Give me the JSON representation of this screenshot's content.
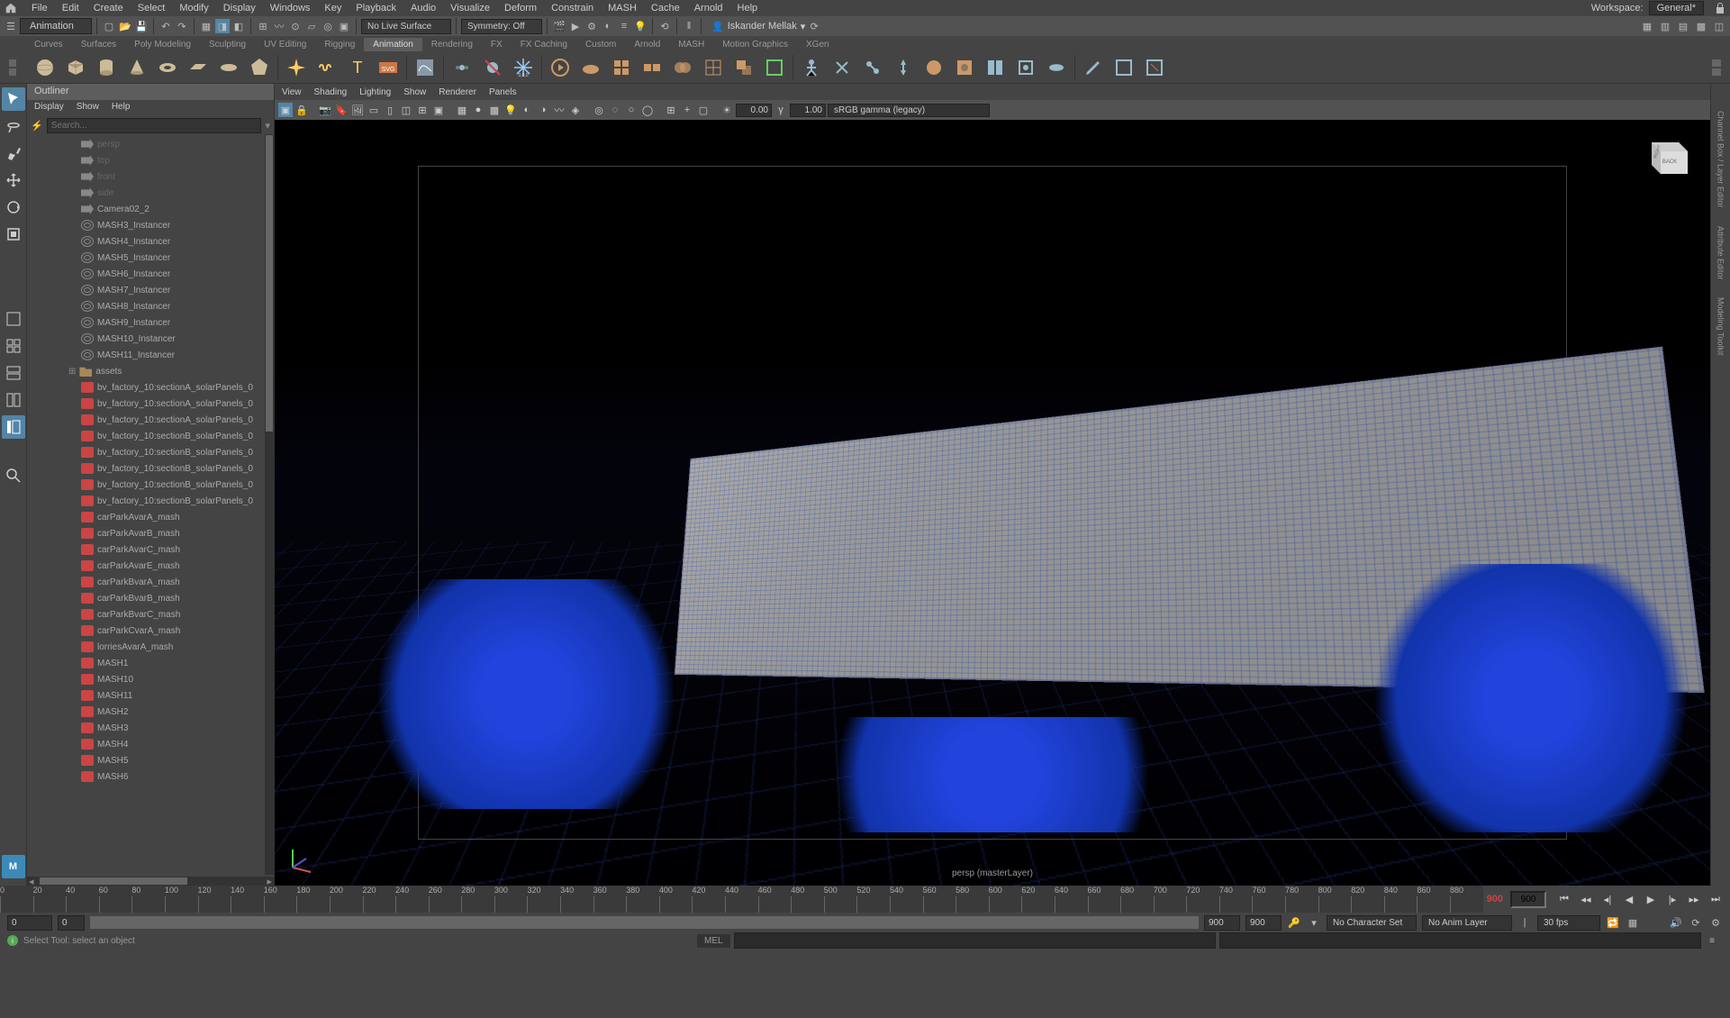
{
  "topMenu": {
    "items": [
      "File",
      "Edit",
      "Create",
      "Select",
      "Modify",
      "Display",
      "Windows",
      "Key",
      "Playback",
      "Audio",
      "Visualize",
      "Deform",
      "Constrain",
      "MASH",
      "Cache",
      "Arnold",
      "Help"
    ],
    "workspaceLabel": "Workspace:",
    "workspaceValue": "General*"
  },
  "statusBar": {
    "mode": "Animation",
    "noLiveSurface": "No Live Surface",
    "symmetry": "Symmetry: Off",
    "user": "Iskander Mellak"
  },
  "shelfTabs": [
    "Curves",
    "Surfaces",
    "Poly Modeling",
    "Sculpting",
    "UV Editing",
    "Rigging",
    "Animation",
    "Rendering",
    "FX",
    "FX Caching",
    "Custom",
    "Arnold",
    "MASH",
    "Motion Graphics",
    "XGen"
  ],
  "outliner": {
    "title": "Outliner",
    "menu": [
      "Display",
      "Show",
      "Help"
    ],
    "searchPlaceholder": "Search...",
    "items": [
      {
        "type": "cam",
        "label": "persp",
        "dim": true
      },
      {
        "type": "cam",
        "label": "top",
        "dim": true
      },
      {
        "type": "cam",
        "label": "front",
        "dim": true
      },
      {
        "type": "cam",
        "label": "side",
        "dim": true
      },
      {
        "type": "cam",
        "label": "Camera02_2"
      },
      {
        "type": "inst",
        "label": "MASH3_Instancer"
      },
      {
        "type": "inst",
        "label": "MASH4_Instancer"
      },
      {
        "type": "inst",
        "label": "MASH5_Instancer"
      },
      {
        "type": "inst",
        "label": "MASH6_Instancer"
      },
      {
        "type": "inst",
        "label": "MASH7_Instancer"
      },
      {
        "type": "inst",
        "label": "MASH8_Instancer"
      },
      {
        "type": "inst",
        "label": "MASH9_Instancer"
      },
      {
        "type": "inst",
        "label": "MASH10_Instancer"
      },
      {
        "type": "inst",
        "label": "MASH11_Instancer"
      },
      {
        "type": "folder",
        "label": "assets",
        "expandable": true
      },
      {
        "type": "mesh",
        "label": "bv_factory_10:sectionA_solarPanels_0"
      },
      {
        "type": "mesh",
        "label": "bv_factory_10:sectionA_solarPanels_0"
      },
      {
        "type": "mesh",
        "label": "bv_factory_10:sectionA_solarPanels_0"
      },
      {
        "type": "mesh",
        "label": "bv_factory_10:sectionB_solarPanels_0"
      },
      {
        "type": "mesh",
        "label": "bv_factory_10:sectionB_solarPanels_0"
      },
      {
        "type": "mesh",
        "label": "bv_factory_10:sectionB_solarPanels_0"
      },
      {
        "type": "mesh",
        "label": "bv_factory_10:sectionB_solarPanels_0"
      },
      {
        "type": "mesh",
        "label": "bv_factory_10:sectionB_solarPanels_0"
      },
      {
        "type": "mash",
        "label": "carParkAvarA_mash"
      },
      {
        "type": "mash",
        "label": "carParkAvarB_mash"
      },
      {
        "type": "mash",
        "label": "carParkAvarC_mash"
      },
      {
        "type": "mash",
        "label": "carParkAvarE_mash"
      },
      {
        "type": "mash",
        "label": "carParkBvarA_mash"
      },
      {
        "type": "mash",
        "label": "carParkBvarB_mash"
      },
      {
        "type": "mash",
        "label": "carParkBvarC_mash"
      },
      {
        "type": "mash",
        "label": "carParkCvarA_mash"
      },
      {
        "type": "mash",
        "label": "lorriesAvarA_mash"
      },
      {
        "type": "mash",
        "label": "MASH1"
      },
      {
        "type": "mash",
        "label": "MASH10"
      },
      {
        "type": "mash",
        "label": "MASH11"
      },
      {
        "type": "mash",
        "label": "MASH2"
      },
      {
        "type": "mash",
        "label": "MASH3"
      },
      {
        "type": "mash",
        "label": "MASH4"
      },
      {
        "type": "mash",
        "label": "MASH5"
      },
      {
        "type": "mash",
        "label": "MASH6"
      }
    ]
  },
  "viewport": {
    "menu": [
      "View",
      "Shading",
      "Lighting",
      "Show",
      "Renderer",
      "Panels"
    ],
    "exposure": "0.00",
    "gamma": "1.00",
    "colorSpace": "sRGB gamma (legacy)",
    "label": "persp (masterLayer)",
    "cubeFaces": {
      "right": "RIGHT",
      "back": "BACK"
    }
  },
  "rightTabs": [
    "Channel Box / Layer Editor",
    "Attribute Editor",
    "Modeling Toolkit"
  ],
  "timeline": {
    "ticks": [
      0,
      20,
      40,
      60,
      80,
      100,
      120,
      140,
      160,
      180,
      200,
      220,
      240,
      260,
      280,
      300,
      320,
      340,
      360,
      380,
      400,
      420,
      440,
      460,
      480,
      500,
      520,
      540,
      560,
      580,
      600,
      620,
      640,
      660,
      680,
      700,
      720,
      740,
      760,
      780,
      800,
      820,
      840,
      860,
      880,
      900
    ],
    "current": "900",
    "endField": "900"
  },
  "rangeSlider": {
    "start": "0",
    "rangeStart": "0",
    "rangeEnd": "900",
    "end": "900",
    "characterSet": "No Character Set",
    "animLayer": "No Anim Layer",
    "fps": "30 fps"
  },
  "commandLine": {
    "lang": "MEL"
  },
  "helpLine": {
    "text": "Select Tool: select an object"
  }
}
